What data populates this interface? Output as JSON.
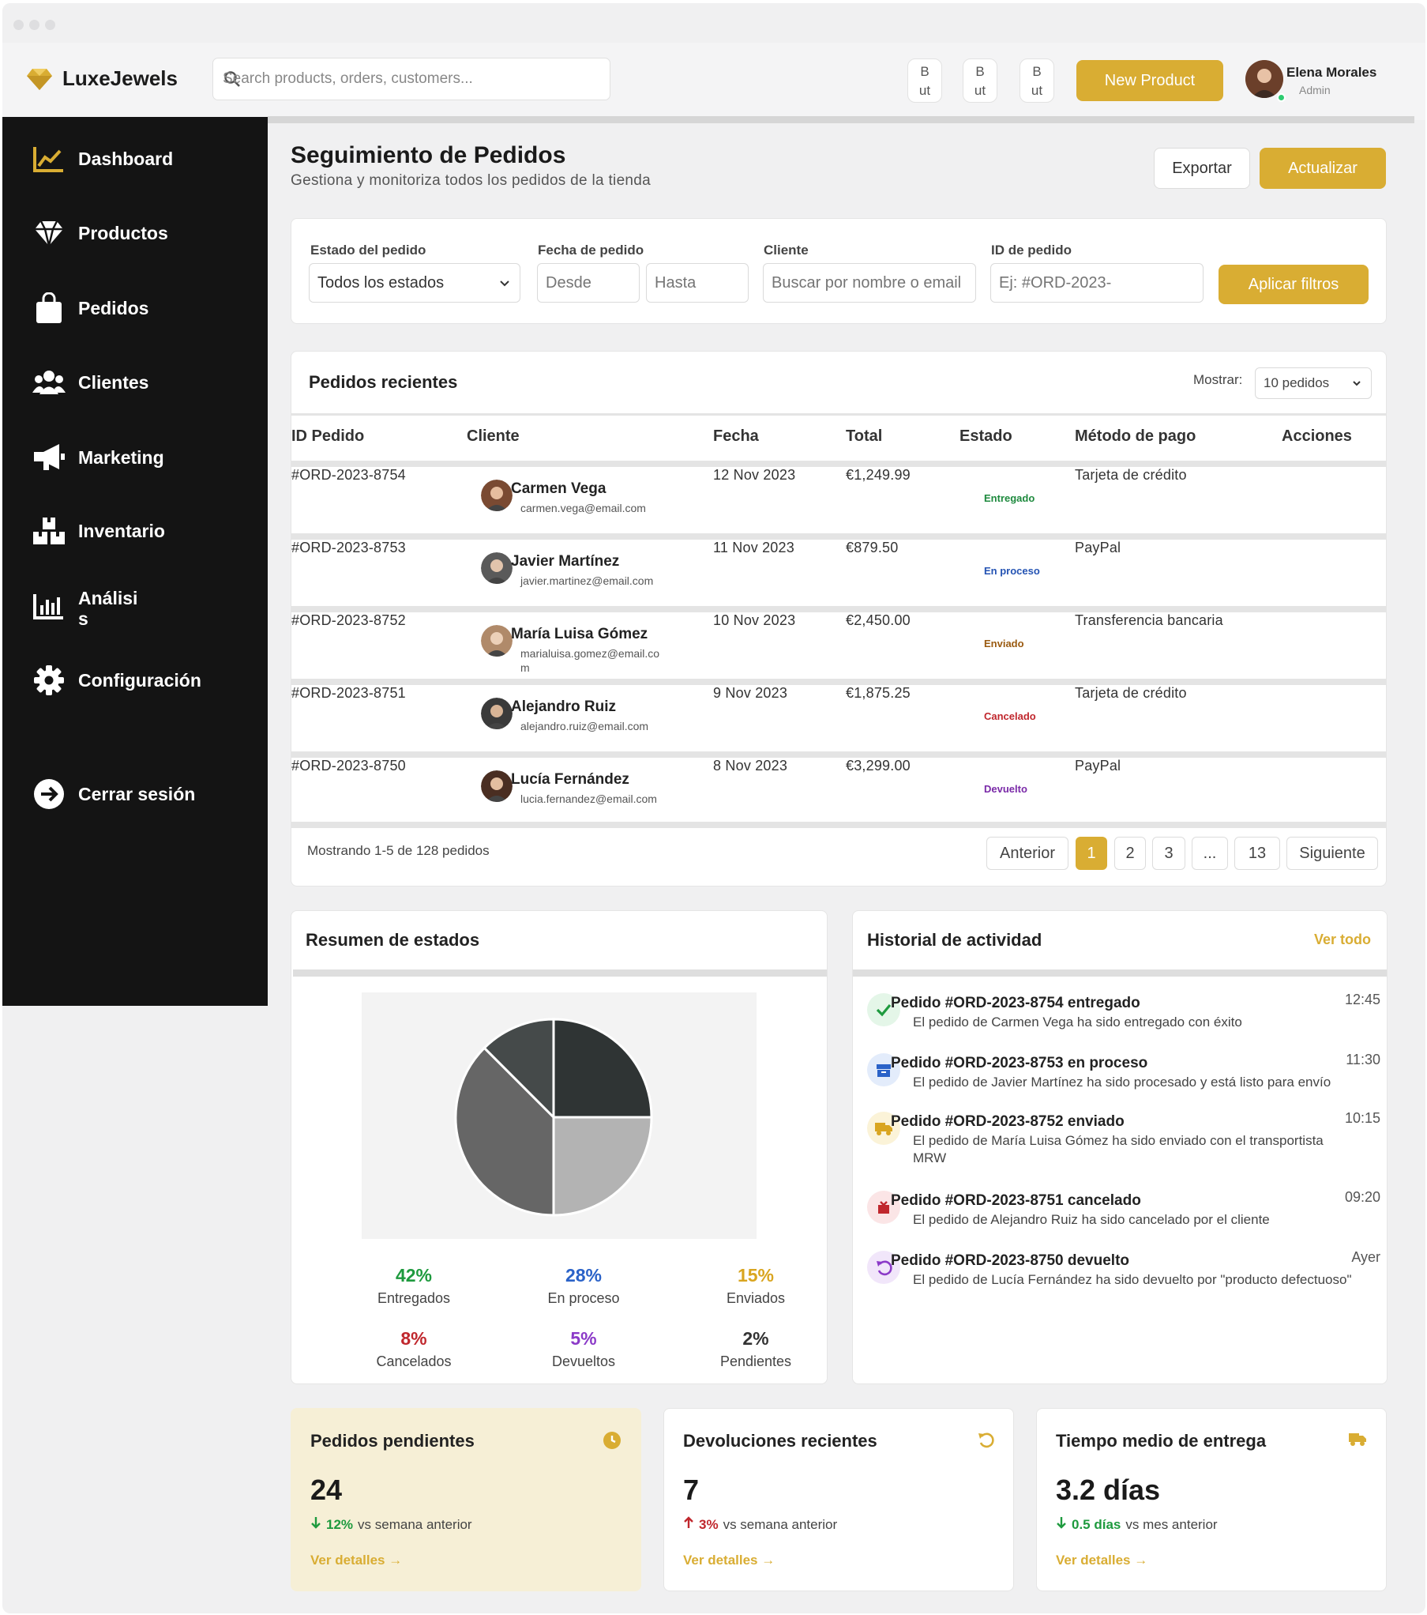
{
  "app": {
    "name": "LuxeJewels"
  },
  "search": {
    "placeholder": "Search products, orders, customers..."
  },
  "topbar": {
    "small_buttons": [
      {
        "line1": "B",
        "line2": "ut"
      },
      {
        "line1": "B",
        "line2": "ut"
      },
      {
        "line1": "B",
        "line2": "ut"
      }
    ],
    "new_product_label": "New Product",
    "user_name": "Elena Morales",
    "user_role": "Admin"
  },
  "sidebar": {
    "items": [
      {
        "label": "Dashboard",
        "icon": "chart-line-icon"
      },
      {
        "label": "Productos",
        "icon": "diamond-icon"
      },
      {
        "label": "Pedidos",
        "icon": "shopping-bag-icon"
      },
      {
        "label": "Clientes",
        "icon": "users-icon"
      },
      {
        "label": "Marketing",
        "icon": "megaphone-icon"
      },
      {
        "label": "Inventario",
        "icon": "boxes-icon"
      },
      {
        "label": "Análisi\ns",
        "icon": "bar-chart-icon"
      },
      {
        "label": "Configuración",
        "icon": "gear-icon"
      }
    ],
    "logout_label": "Cerrar sesión"
  },
  "page": {
    "title": "Seguimiento de Pedidos",
    "subtitle": "Gestiona y monitoriza todos los pedidos de la tienda",
    "export_label": "Exportar",
    "refresh_label": "Actualizar"
  },
  "filters": {
    "status_label": "Estado del pedido",
    "status_value": "Todos los estados",
    "date_label": "Fecha de pedido",
    "date_from_placeholder": "Desde",
    "date_to_placeholder": "Hasta",
    "client_label": "Cliente",
    "client_placeholder": "Buscar por nombre o email",
    "id_label": "ID de pedido",
    "id_placeholder": "Ej: #ORD-2023-",
    "apply_label": "Aplicar filtros"
  },
  "orders": {
    "title": "Pedidos recientes",
    "show_label": "Mostrar:",
    "show_value": "10 pedidos",
    "columns": [
      "ID Pedido",
      "Cliente",
      "Fecha",
      "Total",
      "Estado",
      "Método de pago",
      "Acciones"
    ],
    "rows": [
      {
        "id": "#ORD-2023-8754",
        "name": "Carmen Vega",
        "email": "carmen.vega@email.com",
        "date": "12 Nov 2023",
        "total": "€1,249.99",
        "status": "Entregado",
        "status_color": "#1e8a3e",
        "payment": "Tarjeta de crédito"
      },
      {
        "id": "#ORD-2023-8753",
        "name": "Javier Martínez",
        "email": "javier.martinez@email.com",
        "date": "11 Nov 2023",
        "total": "€879.50",
        "status": "En proceso",
        "status_color": "#2453b3",
        "payment": "PayPal"
      },
      {
        "id": "#ORD-2023-8752",
        "name": "María Luisa Gómez",
        "email": "marialuisa.gomez@email.co\nm",
        "date": "10 Nov 2023",
        "total": "€2,450.00",
        "status": "Enviado",
        "status_color": "#9a5a10",
        "payment": "Transferencia bancaria"
      },
      {
        "id": "#ORD-2023-8751",
        "name": "Alejandro Ruiz",
        "email": "alejandro.ruiz@email.com",
        "date": "9 Nov 2023",
        "total": "€1,875.25",
        "status": "Cancelado",
        "status_color": "#c0272d",
        "payment": "Tarjeta de crédito"
      },
      {
        "id": "#ORD-2023-8750",
        "name": "Lucía Fernández",
        "email": "lucia.fernandez@email.com",
        "date": "8 Nov 2023",
        "total": "€3,299.00",
        "status": "Devuelto",
        "status_color": "#7a2aa8",
        "payment": "PayPal"
      }
    ],
    "footer_text": "Mostrando 1-5 de 128 pedidos",
    "pagination": {
      "prev": "Anterior",
      "pages": [
        "1",
        "2",
        "3",
        "...",
        "13"
      ],
      "next": "Siguiente"
    }
  },
  "status_summary": {
    "title": "Resumen de estados",
    "items": [
      {
        "pct": "42%",
        "label": "Entregados",
        "color": "#1e9a3e"
      },
      {
        "pct": "28%",
        "label": "En proceso",
        "color": "#2a62c8"
      },
      {
        "pct": "15%",
        "label": "Enviados",
        "color": "#d9a520"
      },
      {
        "pct": "8%",
        "label": "Cancelados",
        "color": "#c0272d"
      },
      {
        "pct": "5%",
        "label": "Devueltos",
        "color": "#8b3ac8"
      },
      {
        "pct": "2%",
        "label": "Pendientes",
        "color": "#333333"
      }
    ]
  },
  "chart_data": {
    "type": "pie",
    "title": "",
    "slices": [
      {
        "value": 25,
        "color": "#2f3434"
      },
      {
        "value": 25,
        "color": "#b3b3b3"
      },
      {
        "value": 37.5,
        "color": "#666666"
      },
      {
        "value": 12.5,
        "color": "#454a4a"
      }
    ]
  },
  "activity": {
    "title": "Historial de actividad",
    "see_all": "Ver todo",
    "items": [
      {
        "title": "Pedido #ORD-2023-8754 entregado",
        "desc": "El pedido de Carmen Vega ha sido entregado con éxito",
        "time": "12:45",
        "icon": "check-icon",
        "bg": "#e4f6e8",
        "fg": "#1e9a3e"
      },
      {
        "title": "Pedido #ORD-2023-8753 en proceso",
        "desc": "El pedido de Javier Martínez ha sido procesado y está listo para envío",
        "time": "11:30",
        "icon": "box-icon",
        "bg": "#e3ecfb",
        "fg": "#2a62c8"
      },
      {
        "title": "Pedido #ORD-2023-8752 enviado",
        "desc": "El pedido de María Luisa Gómez ha sido enviado con el transportista MRW",
        "time": "10:15",
        "icon": "truck-icon",
        "bg": "#fbf3d8",
        "fg": "#d9a520"
      },
      {
        "title": "Pedido #ORD-2023-8751 cancelado",
        "desc": "El pedido de Alejandro Ruiz ha sido cancelado por el cliente",
        "time": "09:20",
        "icon": "cancel-icon",
        "bg": "#fbe5e6",
        "fg": "#c0272d"
      },
      {
        "title": "Pedido #ORD-2023-8750 devuelto",
        "desc": "El pedido de Lucía Fernández ha sido devuelto por \"producto defectuoso\"",
        "time": "Ayer",
        "icon": "undo-icon",
        "bg": "#f1e6fa",
        "fg": "#8b3ac8"
      }
    ]
  },
  "kpis": [
    {
      "title": "Pedidos pendientes",
      "value": "24",
      "change": "12%",
      "direction": "down",
      "change_color": "#1e9a3e",
      "suffix": "vs semana anterior",
      "link": "Ver detalles →",
      "icon": "clock-icon",
      "bg": "#f6efd6"
    },
    {
      "title": "Devoluciones recientes",
      "value": "7",
      "change": "3%",
      "direction": "up",
      "change_color": "#c0272d",
      "suffix": "vs semana anterior",
      "link": "Ver detalles →",
      "icon": "undo-icon",
      "bg": "#ffffff"
    },
    {
      "title": "Tiempo medio de entrega",
      "value": "3.2 días",
      "change": "0.5 días",
      "direction": "down",
      "change_color": "#1e9a3e",
      "suffix": "vs mes anterior",
      "link": "Ver detalles →",
      "icon": "truck-icon",
      "bg": "#ffffff"
    }
  ]
}
